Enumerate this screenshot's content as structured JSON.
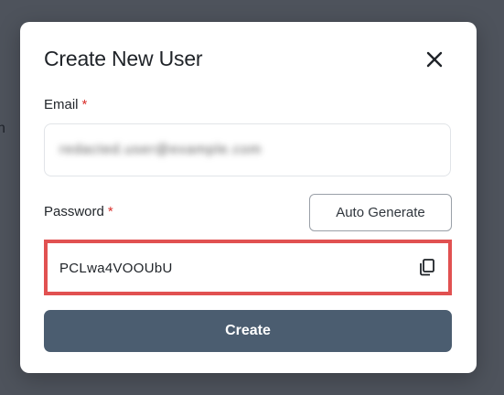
{
  "backdrop": {
    "glyph": "n"
  },
  "modal": {
    "title": "Create New User",
    "close_icon": "close-icon"
  },
  "email": {
    "label": "Email",
    "required_mark": "*",
    "value": "redacted.user@example.com"
  },
  "password": {
    "label": "Password",
    "required_mark": "*",
    "value": "PCLwa4VOOUbU",
    "copy_icon": "copy-icon",
    "auto_generate_label": "Auto Generate"
  },
  "actions": {
    "create_label": "Create"
  },
  "colors": {
    "backdrop": "#4e535c",
    "primary_button": "#4b5d70",
    "required": "#d9302c",
    "highlight_border": "#e15151"
  }
}
